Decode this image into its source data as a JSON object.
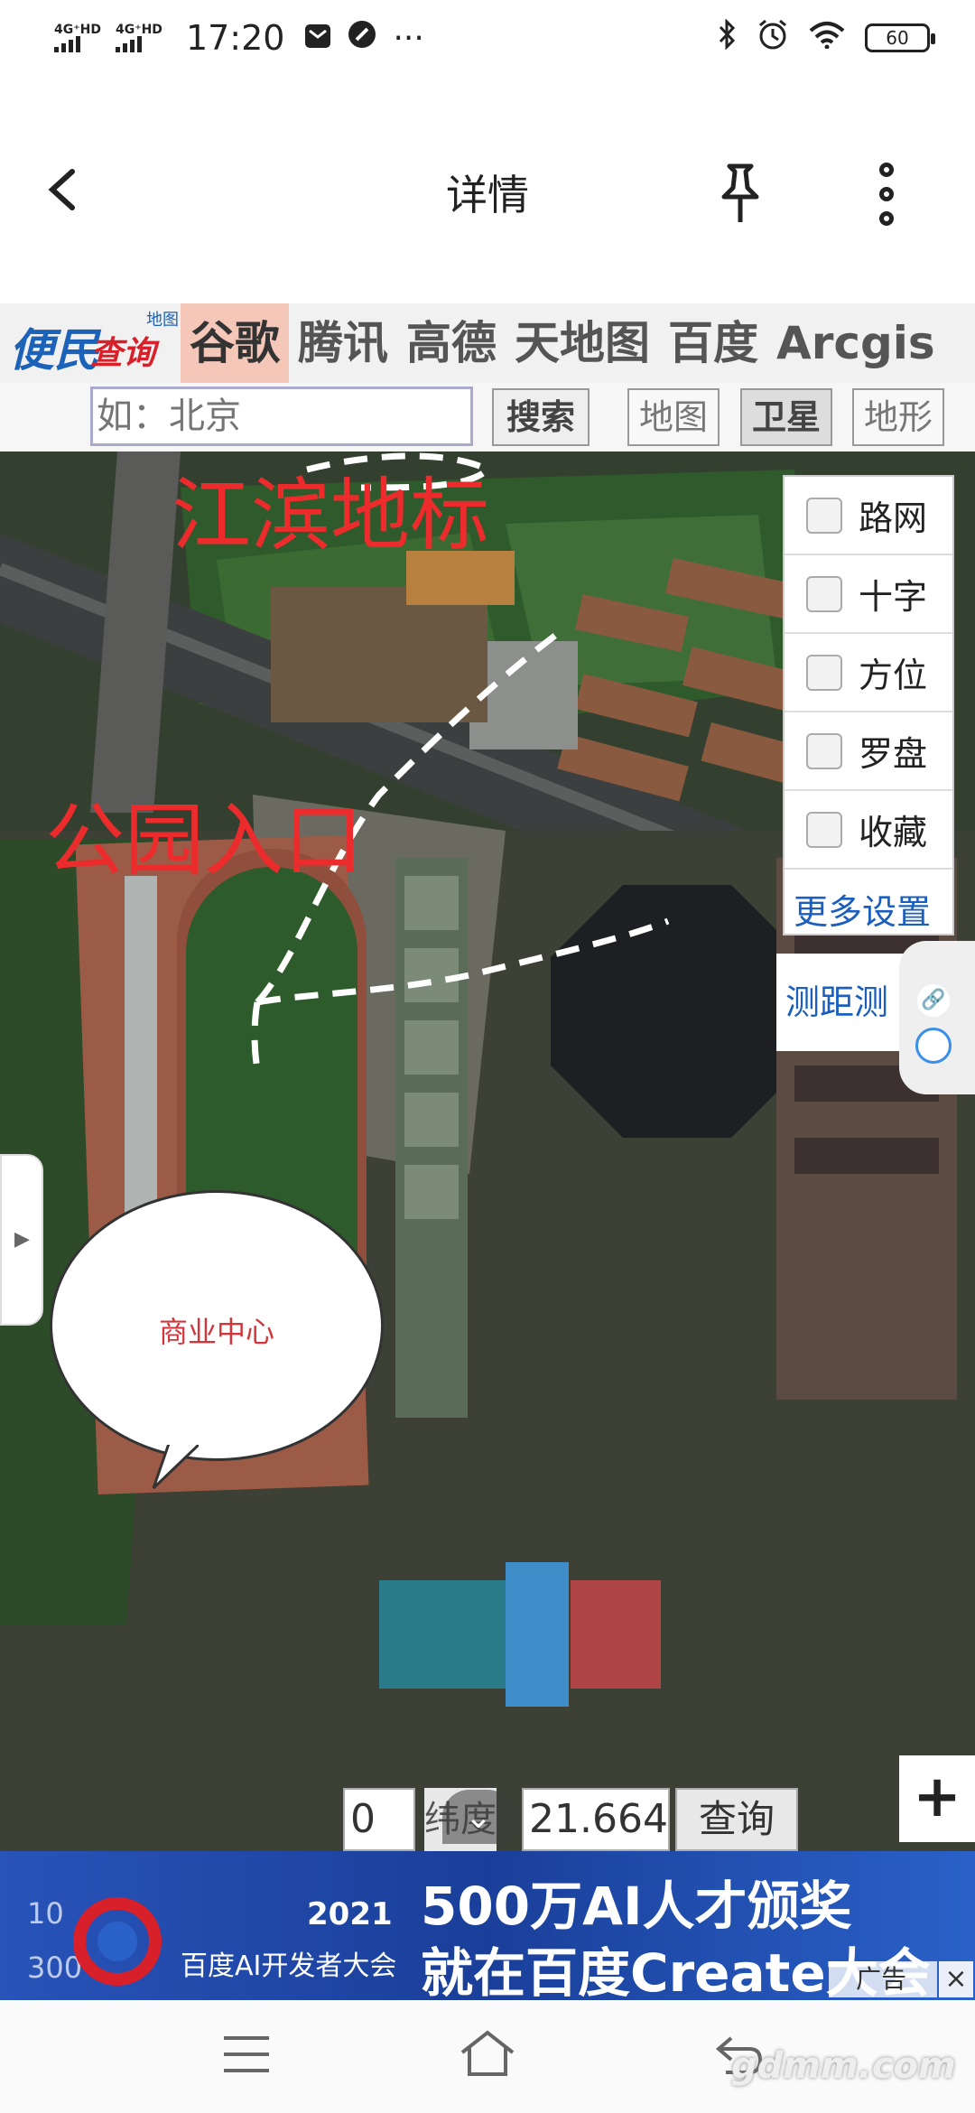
{
  "status_bar": {
    "signal_1": "4G⁺HD",
    "signal_2": "4G⁺HD",
    "time": "17:20",
    "more_label": "···",
    "battery": "60"
  },
  "header": {
    "back_icon": "chevron-left-icon",
    "title": "详情",
    "pin_icon": "pin-icon",
    "more_icon": "more-vertical-icon"
  },
  "source_bar": {
    "logo_main": "便民",
    "logo_sub": "查询网",
    "logo_tag": "地图",
    "tabs": [
      {
        "label": "谷歌",
        "active": true
      },
      {
        "label": "腾讯",
        "active": false
      },
      {
        "label": "高德",
        "active": false
      },
      {
        "label": "天地图",
        "active": false
      },
      {
        "label": "百度",
        "active": false
      },
      {
        "label": "Arcgis",
        "active": false
      }
    ]
  },
  "search_row": {
    "placeholder": "如：北京",
    "search_label": "搜索",
    "map_label": "地图",
    "satellite_label": "卫星",
    "terrain_label": "地形"
  },
  "map": {
    "annotation_1": "江滨地标",
    "annotation_2": "公园入口",
    "annotation_color": "#ec2c2c",
    "layers": [
      {
        "label": "路网",
        "checked": false
      },
      {
        "label": "十字",
        "checked": false
      },
      {
        "label": "方位",
        "checked": false
      },
      {
        "label": "罗盘",
        "checked": false
      },
      {
        "label": "收藏",
        "checked": false
      }
    ],
    "more_settings": "更多设置",
    "measure_label": "测距测",
    "zoom_in": "+",
    "coord_left_value": "0",
    "lat_label": "纬度",
    "lat_value": "21.664",
    "query_label": "查询",
    "callout_text": "商业中心"
  },
  "ad": {
    "year": "2021",
    "conference": "百度AI开发者大会",
    "line_1": "500万AI人才颁奖",
    "line_2": "就在百度Create大会",
    "tag": "广告",
    "close": "×",
    "num_1": "10",
    "num_2": "300"
  },
  "watermark": "gdmm.com"
}
